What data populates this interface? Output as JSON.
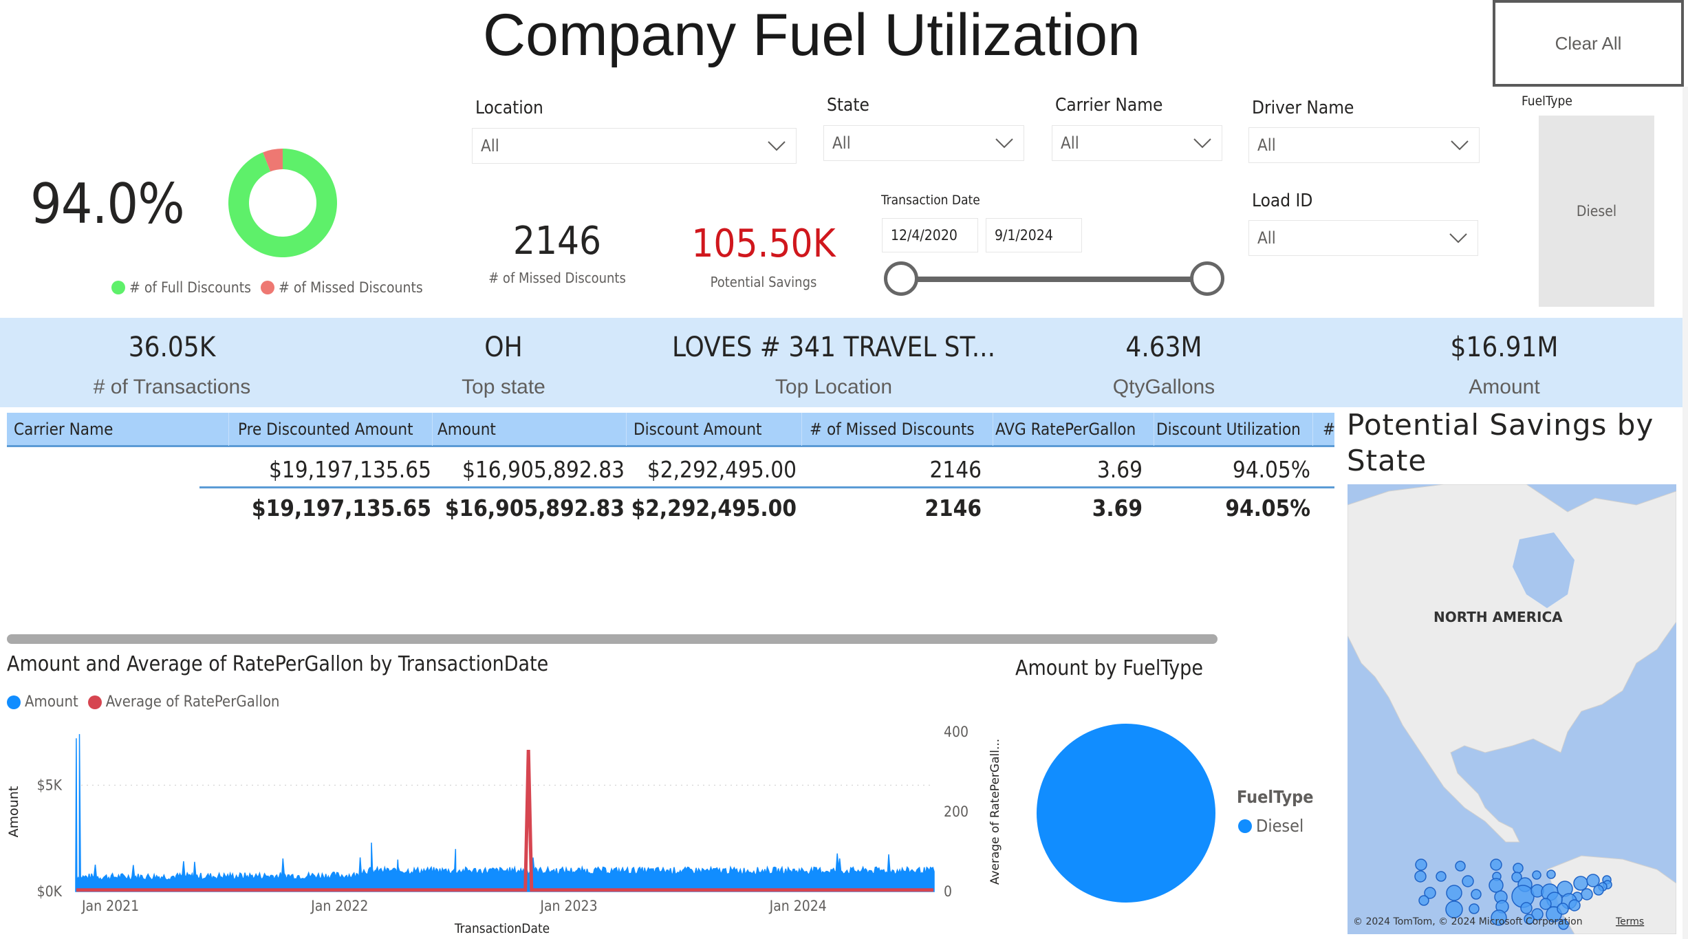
{
  "header": {
    "title": "Company Fuel Utilization",
    "clear_all_label": "Clear All"
  },
  "utilization": {
    "percent_label": "94.0%",
    "legend": [
      {
        "label": "# of Full Discounts",
        "color": "#5ef06a"
      },
      {
        "label": "# of Missed Discounts",
        "color": "#ee7872"
      }
    ],
    "donut": {
      "full_share": 0.9405,
      "missed_share": 0.0595
    }
  },
  "cards": {
    "missed_discounts": {
      "value": "2146",
      "label": "# of Missed Discounts"
    },
    "potential_savings": {
      "value": "105.50K",
      "label": "Potential Savings",
      "color": "#d0171d"
    }
  },
  "slicers": {
    "location": {
      "label": "Location",
      "value": "All"
    },
    "state": {
      "label": "State",
      "value": "All"
    },
    "carrier_name": {
      "label": "Carrier Name",
      "value": "All"
    },
    "driver_name": {
      "label": "Driver Name",
      "value": "All"
    },
    "load_id": {
      "label": "Load ID",
      "value": "All"
    },
    "transaction_date": {
      "label": "Transaction Date",
      "start": "12/4/2020",
      "end": "9/1/2024",
      "range_start_fraction": 0.0,
      "range_end_fraction": 1.0
    },
    "fuel_type": {
      "label": "FuelType",
      "option": "Diesel"
    }
  },
  "kpis": [
    {
      "value": "36.05K",
      "label": "# of Transactions"
    },
    {
      "value": "OH",
      "label": "Top state"
    },
    {
      "value": "LOVES # 341 TRAVEL ST...",
      "label": "Top Location"
    },
    {
      "value": "4.63M",
      "label": "QtyGallons"
    },
    {
      "value": "$16.91M",
      "label": "Amount"
    }
  ],
  "table": {
    "columns": [
      "Carrier Name",
      "Pre Discounted Amount",
      "Amount",
      "Discount Amount",
      "# of Missed Discounts",
      "AVG RatePerGallon",
      "Discount Utilization",
      "#"
    ],
    "rows": [
      [
        "",
        "$19,197,135.65",
        "$16,905,892.83",
        "$2,292,495.00",
        "2146",
        "3.69",
        "94.05%"
      ]
    ],
    "total": [
      "",
      "$19,197,135.65",
      "$16,905,892.83",
      "$2,292,495.00",
      "2146",
      "3.69",
      "94.05%"
    ]
  },
  "chart_data": [
    {
      "type": "line",
      "title": "Amount and Average of RatePerGallon by TransactionDate",
      "xlabel": "TransactionDate",
      "ylabel": "Amount",
      "y2label": "Average of RatePerGall...",
      "x_ticks": [
        "Jan 2021",
        "Jan 2022",
        "Jan 2023",
        "Jan 2024"
      ],
      "x_range": [
        "2020-12-04",
        "2024-09-01"
      ],
      "y_ticks": [
        "$0K",
        "$5K"
      ],
      "ylim": [
        0,
        7500
      ],
      "y2_ticks": [
        "0",
        "200",
        "400"
      ],
      "y2lim": [
        0,
        400
      ],
      "grid": true,
      "legend_position": "top-left",
      "series": [
        {
          "name": "Amount",
          "color": "#118dff",
          "axis": "left",
          "description": "daily amount, mostly 400-1200 with spikes",
          "points": [
            {
              "x": "2020-12-05",
              "y": 7200
            },
            {
              "x": "2020-12-10",
              "y": 7400
            },
            {
              "x": "2021-01-15",
              "y": 500
            },
            {
              "x": "2021-06-01",
              "y": 700
            },
            {
              "x": "2021-12-01",
              "y": 700
            },
            {
              "x": "2022-03-20",
              "y": 2300
            },
            {
              "x": "2022-05-01",
              "y": 1500
            },
            {
              "x": "2022-08-01",
              "y": 2000
            },
            {
              "x": "2022-12-01",
              "y": 1000
            },
            {
              "x": "2023-06-01",
              "y": 900
            },
            {
              "x": "2024-01-15",
              "y": 1200
            },
            {
              "x": "2024-08-31",
              "y": 900
            }
          ]
        },
        {
          "name": "Average of RatePerGallon",
          "color": "#d64550",
          "axis": "right",
          "description": "near 3.7 throughout with a single spike",
          "points": [
            {
              "x": "2020-12-05",
              "y": 4
            },
            {
              "x": "2022-11-20",
              "y": 4
            },
            {
              "x": "2022-11-25",
              "y": 355
            },
            {
              "x": "2022-11-30",
              "y": 4
            },
            {
              "x": "2024-08-31",
              "y": 4
            }
          ]
        }
      ]
    },
    {
      "type": "pie",
      "title": "Amount by FuelType",
      "legend_title": "FuelType",
      "legend_position": "right",
      "categories": [
        "Diesel"
      ],
      "values": [
        16905892.83
      ],
      "colors": [
        "#118dff"
      ]
    },
    {
      "type": "scatter",
      "title": "Potential Savings by State",
      "map_label": "NORTH AMERICA",
      "attribution": "© 2024 TomTom, © 2024 Microsoft Corporation",
      "terms_label": "Terms",
      "bubble_color": "#4d9ff5"
    }
  ]
}
